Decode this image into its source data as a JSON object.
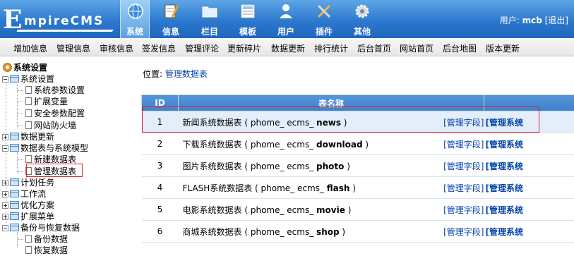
{
  "brand": {
    "logo_initial": "E",
    "logo_rest": "mpireCMS"
  },
  "top_nav": [
    {
      "label": "系统",
      "icon": "globe-icon",
      "active": true
    },
    {
      "label": "信息",
      "icon": "notepad-icon"
    },
    {
      "label": "栏目",
      "icon": "folder-icon"
    },
    {
      "label": "模板",
      "icon": "template-icon"
    },
    {
      "label": "用户",
      "icon": "user-icon"
    },
    {
      "label": "插件",
      "icon": "tools-icon"
    },
    {
      "label": "其他",
      "icon": "gear-icon"
    }
  ],
  "user": {
    "label": "用户:",
    "name": "mcb",
    "logout": "[退出]"
  },
  "sub_nav": [
    "增加信息",
    "管理信息",
    "审核信息",
    "签发信息",
    "管理评论",
    "更新碎片",
    "数据更新",
    "排行统计",
    "后台首页",
    "网站首页",
    "后台地图",
    "版本更新"
  ],
  "sidebar": {
    "title": "系统设置",
    "items": [
      {
        "label": "系统设置",
        "type": "folder",
        "state": "open"
      },
      {
        "label": "系统参数设置",
        "type": "doc"
      },
      {
        "label": "扩展变量",
        "type": "doc"
      },
      {
        "label": "安全参数配置",
        "type": "doc"
      },
      {
        "label": "网站防火墙",
        "type": "doc"
      },
      {
        "label": "数据更新",
        "type": "folder",
        "state": "closed"
      },
      {
        "label": "数据表与系统模型",
        "type": "folder",
        "state": "open"
      },
      {
        "label": "新建数据表",
        "type": "doc"
      },
      {
        "label": "管理数据表",
        "type": "doc",
        "selected": true
      },
      {
        "label": "计划任务",
        "type": "folder",
        "state": "closed"
      },
      {
        "label": "工作流",
        "type": "folder",
        "state": "closed"
      },
      {
        "label": "优化方案",
        "type": "folder",
        "state": "closed"
      },
      {
        "label": "扩展菜单",
        "type": "folder",
        "state": "closed"
      },
      {
        "label": "备份与恢复数据",
        "type": "folder",
        "state": "open"
      },
      {
        "label": "备份数据",
        "type": "doc"
      },
      {
        "label": "恢复数据",
        "type": "doc"
      }
    ]
  },
  "location": {
    "prefix": "位置:",
    "link": "管理数据表"
  },
  "table": {
    "headers": [
      "ID",
      "表名称",
      "管理"
    ],
    "rows": [
      {
        "id": "1",
        "name": "新闻系统数据表",
        "prefix": "( phome_ ecms_",
        "table": "news",
        "suffix": ")",
        "op1": "[管理字段]",
        "op2": "[管理系统"
      },
      {
        "id": "2",
        "name": "下载系统数据表",
        "prefix": "( phome_ ecms_",
        "table": "download",
        "suffix": ")",
        "op1": "[管理字段]",
        "op2": "[管理系统"
      },
      {
        "id": "3",
        "name": "图片系统数据表",
        "prefix": "( phome_ ecms_",
        "table": "photo",
        "suffix": ")",
        "op1": "[管理字段]",
        "op2": "[管理系统"
      },
      {
        "id": "4",
        "name": "FLASH系统数据表",
        "prefix": "( phome_ ecms_",
        "table": "flash",
        "suffix": ")",
        "op1": "[管理字段]",
        "op2": "[管理系统"
      },
      {
        "id": "5",
        "name": "电影系统数据表",
        "prefix": "( phome_ ecms_",
        "table": "movie",
        "suffix": ")",
        "op1": "[管理字段]",
        "op2": "[管理系统"
      },
      {
        "id": "6",
        "name": "商城系统数据表",
        "prefix": "( phome_ ecms_",
        "table": "shop",
        "suffix": ")",
        "op1": "[管理字段]",
        "op2": "[管理系统"
      }
    ]
  }
}
